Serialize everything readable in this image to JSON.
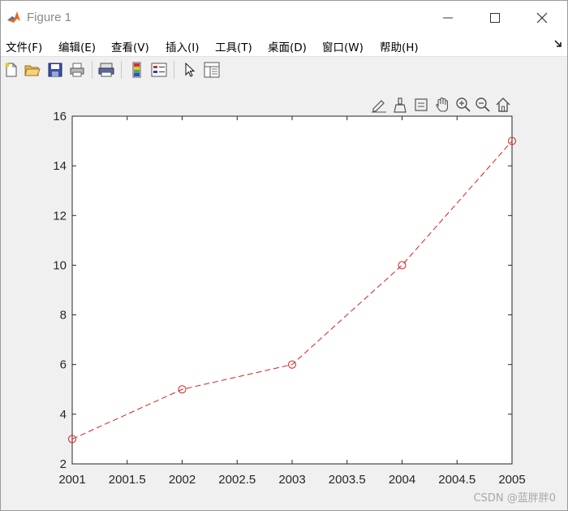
{
  "window": {
    "title": "Figure 1",
    "minimize_label": "—",
    "maximize_label": "☐",
    "close_label": "✕"
  },
  "menu": {
    "items": [
      "文件(F)",
      "编辑(E)",
      "查看(V)",
      "插入(I)",
      "工具(T)",
      "桌面(D)",
      "窗口(W)",
      "帮助(H)"
    ],
    "overflow_icon": "dock-arrow-icon"
  },
  "toolbar": {
    "icons": [
      "new-figure-icon",
      "open-file-icon",
      "save-icon",
      "print-icon",
      "print-preview-icon",
      "colorbar-icon",
      "legend-icon",
      "pointer-icon",
      "property-inspector-icon"
    ]
  },
  "axes_toolbar": {
    "icons": [
      "brush-edit-icon",
      "data-brush-icon",
      "data-tips-icon",
      "pan-hand-icon",
      "zoom-in-icon",
      "zoom-out-icon",
      "home-icon"
    ]
  },
  "watermark": "CSDN @蓝胖胖0",
  "colors": {
    "line": "#d62020",
    "axes_bg": "#ffffff",
    "figure_bg": "#f0f0f0"
  },
  "chart_data": {
    "type": "line",
    "x": [
      2001,
      2002,
      2003,
      2004,
      2005
    ],
    "series": [
      {
        "values": [
          3,
          5,
          6,
          10,
          15
        ],
        "line_style": "dashed",
        "marker": "circle",
        "color": "#d62020"
      }
    ],
    "xlim": [
      2001,
      2005
    ],
    "ylim": [
      2,
      16
    ],
    "xticks": [
      "2001",
      "2001.5",
      "2002",
      "2002.5",
      "2003",
      "2003.5",
      "2004",
      "2004.5",
      "2005"
    ],
    "yticks": [
      "2",
      "4",
      "6",
      "8",
      "10",
      "12",
      "14",
      "16"
    ],
    "grid": false,
    "title": "",
    "xlabel": "",
    "ylabel": ""
  }
}
